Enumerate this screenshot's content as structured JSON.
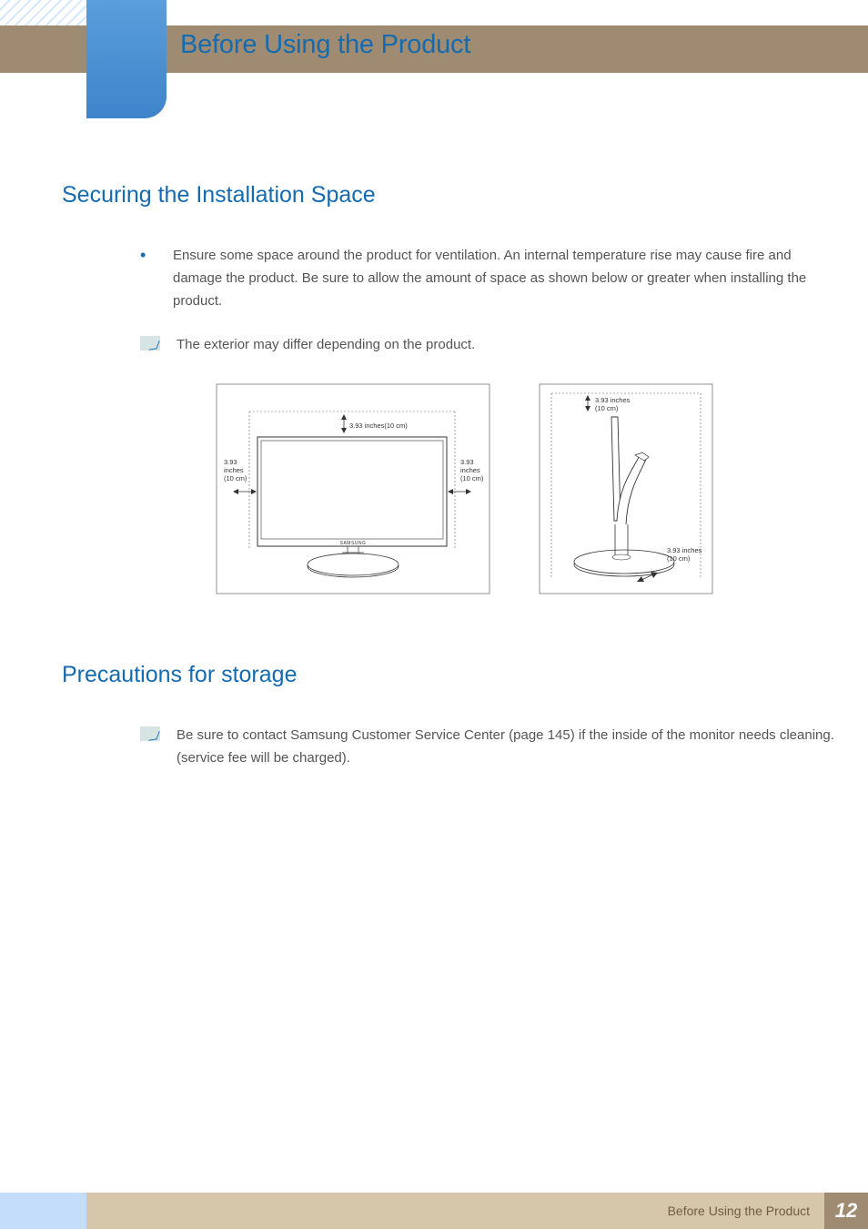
{
  "header": {
    "title": "Before Using the Product"
  },
  "sections": {
    "installation": {
      "heading": "Securing the Installation Space",
      "bullet_text": "Ensure some space around the product for ventilation. An internal temperature rise may cause fire and damage the product. Be sure to allow the amount of space as shown below or greater when installing the product.",
      "note_text": "The exterior may differ depending on the product."
    },
    "storage": {
      "heading": "Precautions for storage",
      "note_text": "Be sure to contact Samsung Customer Service Center (page 145) if the inside of the monitor needs cleaning. (service fee will be charged)."
    }
  },
  "diagram": {
    "labels": {
      "top_front": "3.93 inches(10 cm)",
      "left_front_line1": "3.93",
      "left_front_line2": "inches",
      "left_front_line3": "(10 cm)",
      "right_front_line1": "3.93",
      "right_front_line2": "inches",
      "right_front_line3": "(10 cm)",
      "brand": "SAMSUNG",
      "side_top_line1": "3.93 inches",
      "side_top_line2": "(10 cm)",
      "side_bottom_line1": "3.93 inches",
      "side_bottom_line2": "(10 cm)"
    }
  },
  "footer": {
    "section_name": "Before Using the Product",
    "page_number": "12"
  }
}
